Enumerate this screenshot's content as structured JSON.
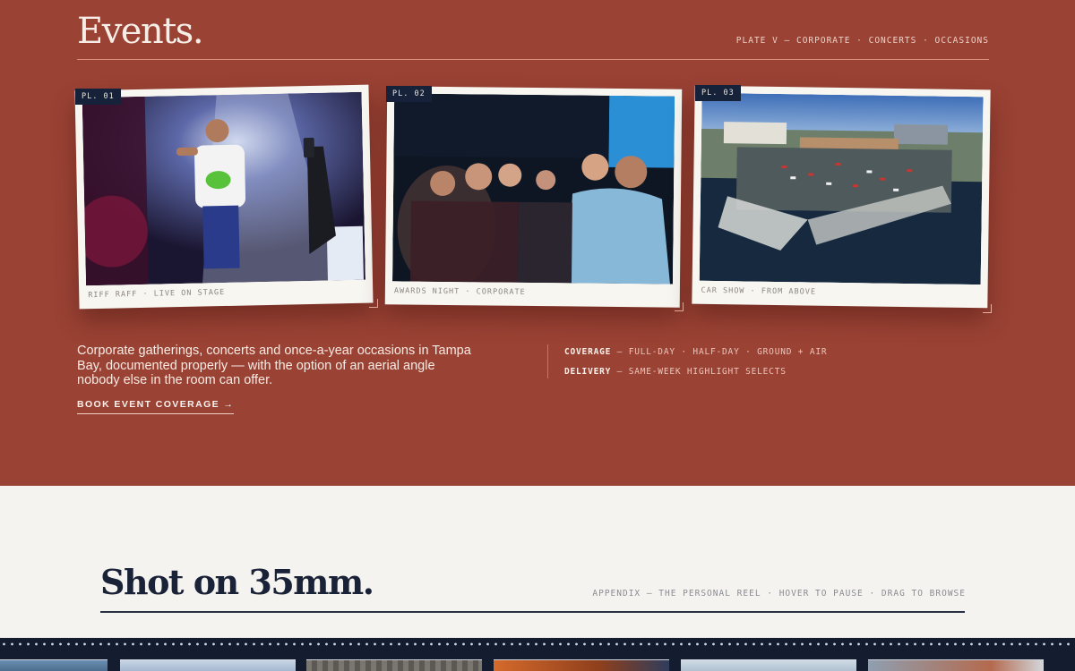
{
  "events": {
    "title": "Events.",
    "meta": "PLATE V — CORPORATE · CONCERTS · OCCASIONS",
    "plates": [
      {
        "tag": "PL. 01",
        "caption": "RIFF RAFF · LIVE ON STAGE"
      },
      {
        "tag": "PL. 02",
        "caption": "AWARDS NIGHT · CORPORATE"
      },
      {
        "tag": "PL. 03",
        "caption": "CAR SHOW · FROM ABOVE"
      }
    ],
    "copy": "Corporate gatherings, concerts and once-a-year occasions in Tampa Bay, documented properly — with the option of an aerial angle nobody else in the room can offer.",
    "cta": "BOOK EVENT COVERAGE →",
    "specs": [
      {
        "label": "COVERAGE",
        "value": " — FULL-DAY · HALF-DAY · GROUND + AIR"
      },
      {
        "label": "DELIVERY",
        "value": " — SAME-WEEK HIGHLIGHT SELECTS"
      }
    ]
  },
  "reel": {
    "title": "Shot on 35mm.",
    "meta": "APPENDIX — THE PERSONAL REEL · HOVER TO PAUSE · DRAG TO BROWSE"
  },
  "colors": {
    "events_bg": "#9a4234",
    "page_bg": "#f5f3ef",
    "navy": "#16213a"
  }
}
